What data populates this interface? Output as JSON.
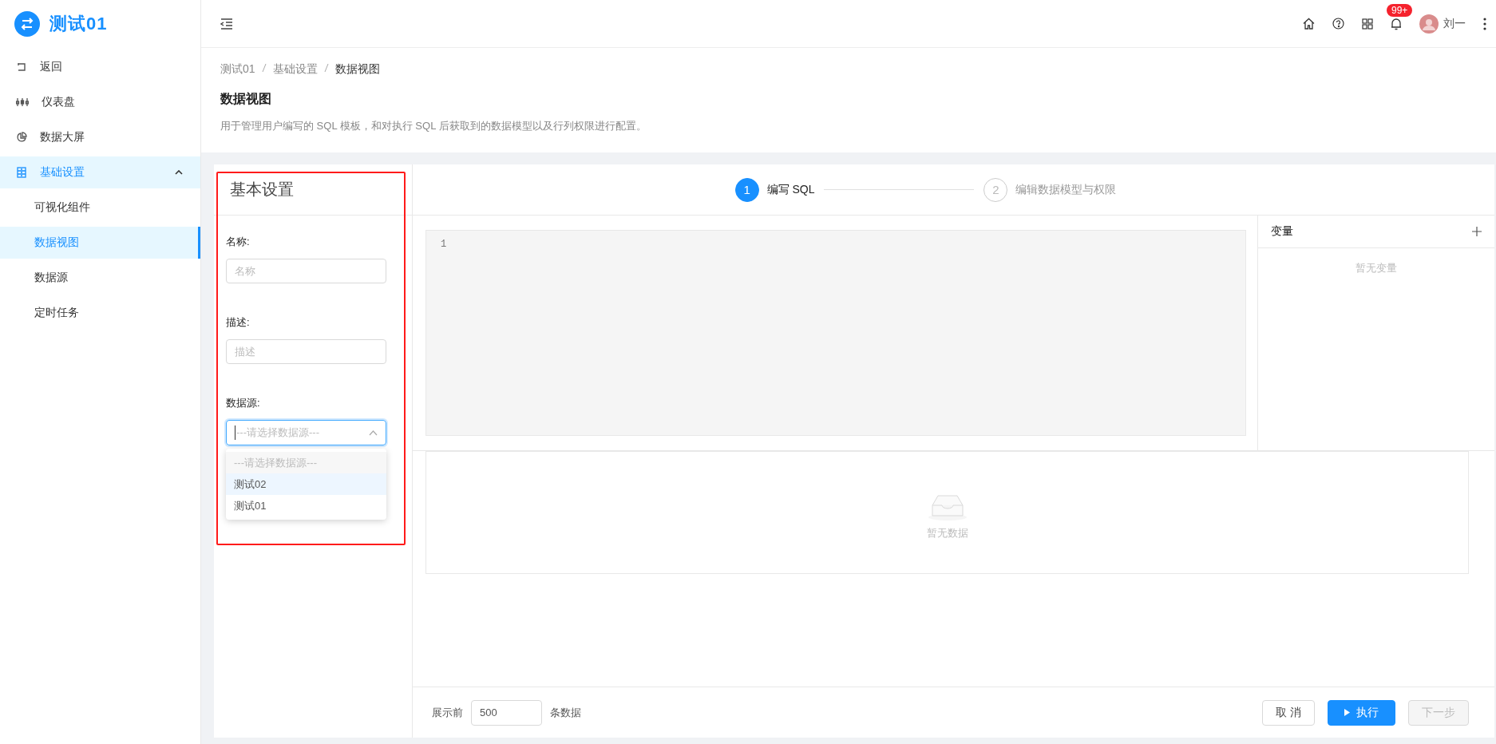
{
  "app": {
    "title": "测试01"
  },
  "sidebar": {
    "items": [
      {
        "label": "返回",
        "selected": false
      },
      {
        "label": "仪表盘",
        "selected": false
      },
      {
        "label": "数据大屏",
        "selected": false
      },
      {
        "label": "基础设置",
        "expanded": true,
        "children": [
          {
            "label": "可视化组件",
            "selected": false
          },
          {
            "label": "数据视图",
            "selected": true
          },
          {
            "label": "数据源",
            "selected": false
          },
          {
            "label": "定时任务",
            "selected": false
          }
        ]
      }
    ]
  },
  "topbar": {
    "badge": "99+",
    "user": "刘一"
  },
  "page": {
    "breadcrumbs": [
      "测试01",
      "基础设置",
      "数据视图"
    ],
    "title": "数据视图",
    "description": "用于管理用户编写的 SQL 模板，和对执行 SQL 后获取到的数据模型以及行列权限进行配置。"
  },
  "settings": {
    "title": "基本设置",
    "fields": [
      {
        "label": "名称:",
        "placeholder": "名称"
      },
      {
        "label": "描述:",
        "placeholder": "描述"
      }
    ],
    "source": {
      "label": "数据源:",
      "placeholder": "---请选择数据源---",
      "expanded": true,
      "options": [
        {
          "label": "---请选择数据源---",
          "disabled": true,
          "hovered": false
        },
        {
          "label": "测试02",
          "disabled": false,
          "hovered": true
        },
        {
          "label": "测试01",
          "disabled": false,
          "hovered": false
        }
      ]
    }
  },
  "steps": [
    {
      "number": "1",
      "label": "编写 SQL",
      "selected": true
    },
    {
      "number": "2",
      "label": "编辑数据模型与权限",
      "selected": false
    }
  ],
  "editor": {
    "line_numbers": [
      "1"
    ]
  },
  "variables": {
    "title": "变量",
    "empty": "暂无变量"
  },
  "results": {
    "empty": "暂无数据"
  },
  "footer": {
    "prefix": "展示前",
    "limit": "500",
    "suffix": "条数据",
    "buttons": [
      {
        "label": "取 消",
        "kind": "default",
        "disabled": false
      },
      {
        "label": "执行",
        "kind": "primary",
        "disabled": false
      },
      {
        "label": "下一步",
        "kind": "default",
        "disabled": true
      }
    ]
  }
}
